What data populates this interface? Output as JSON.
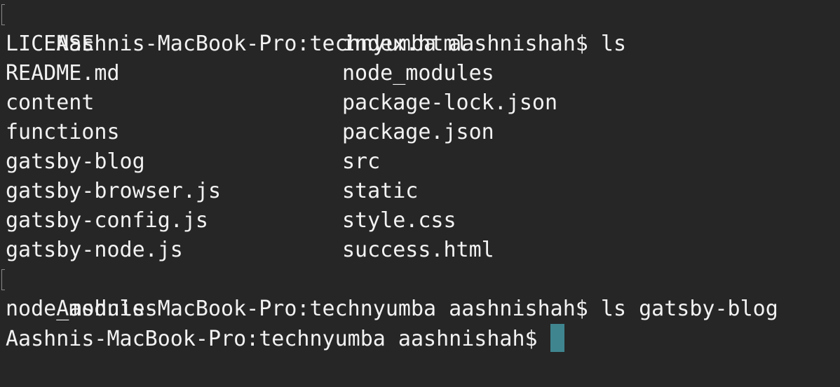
{
  "terminal": {
    "prompt": "Aashnis-MacBook-Pro:technyumba aashnishah$",
    "commands": {
      "ls": "ls",
      "ls_gatsby_blog": "ls gatsby-blog"
    },
    "listing": [
      {
        "left": "LICENSE",
        "right": "index.html"
      },
      {
        "left": "README.md",
        "right": "node_modules"
      },
      {
        "left": "content",
        "right": "package-lock.json"
      },
      {
        "left": "functions",
        "right": "package.json"
      },
      {
        "left": "gatsby-blog",
        "right": "src"
      },
      {
        "left": "gatsby-browser.js",
        "right": "static"
      },
      {
        "left": "gatsby-config.js",
        "right": "style.css"
      },
      {
        "left": "gatsby-node.js",
        "right": "success.html"
      }
    ],
    "gatsby_blog_listing": "node_modules",
    "colors": {
      "background": "#262626",
      "text": "#f2f2f2",
      "cursor": "#3f8590"
    }
  }
}
